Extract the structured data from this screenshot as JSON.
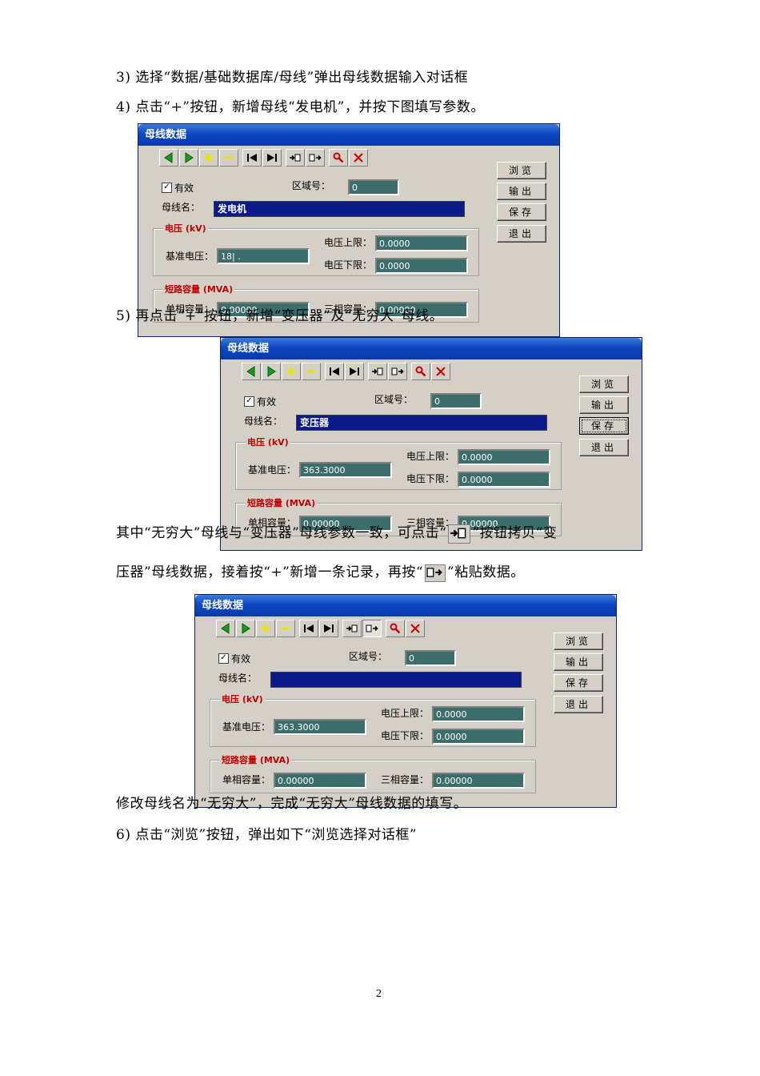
{
  "paragraphs": [
    "3)  选择“数据/基础数据库/母线”弹出母线数据输入对话框",
    "4)  点击“+”按钮，新增母线“发电机”，并按下图填写参数。",
    "5)  再点击“+”按钮，新增“变压器”及“无穷大”母线。",
    "其中“无穷大”母线与“变压器”母线参数一致，可点击“",
    "”按钮拷贝“变",
    "压器”母线数据，接着按“+”新增一条记录，再按“",
    "”粘贴数据。",
    "修改母线名为“无穷大”，完成“无穷大”母线数据的填写。",
    "6)  点击“浏览”按钮，弹出如下“浏览选择对话框”"
  ],
  "page_number": "2",
  "dialog_labels": {
    "title": "母线数据",
    "valid": "有效",
    "check": "✓",
    "area": "区域号：",
    "bus_name": "母线名：",
    "voltage_group": "电压 (kV)",
    "base_voltage": "基准电压：",
    "vmax": "电压上限：",
    "vmin": "电压下限：",
    "sc_group": "短路容量 (MVA)",
    "single_phase": "单相容量：",
    "three_phase": "三相容量：",
    "browse": "浏览",
    "output": "输出",
    "save": "保存",
    "exit": "退出"
  },
  "dialogs": [
    {
      "area": "0",
      "bus_name": "发电机",
      "base_voltage": "18|  .",
      "vmax": "0.0000",
      "vmin": "0.0000",
      "single": "0.00000",
      "three": "0.00000"
    },
    {
      "area": "0",
      "bus_name": "变压器",
      "base_voltage": "363.3000",
      "vmax": "0.0000",
      "vmin": "0.0000",
      "single": "0.00000",
      "three": "0.00000"
    },
    {
      "area": "0",
      "bus_name": "",
      "base_voltage": "363.3000",
      "vmax": "0.0000",
      "vmin": "0.0000",
      "single": "0.00000",
      "three": "0.00000"
    }
  ],
  "toolbar_icons": [
    "prev-icon",
    "next-icon",
    "add-icon",
    "delete-icon",
    "first-icon",
    "last-icon",
    "copy-icon",
    "paste-icon",
    "search-icon",
    "close-icon"
  ],
  "colors": {
    "title_bar": "#0d47c4",
    "field_bg": "#3b6e6b",
    "name_bg": "#0a1a8a",
    "group_title": "#c00000"
  }
}
